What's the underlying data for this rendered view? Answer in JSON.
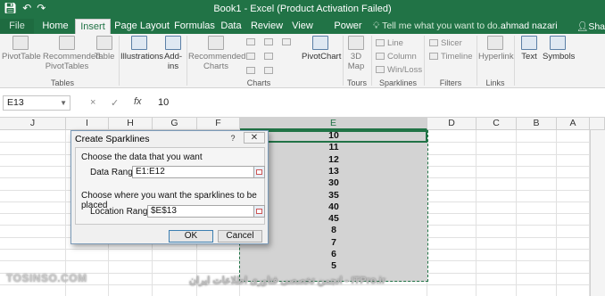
{
  "window": {
    "title": "Book1 - Excel (Product Activation Failed)",
    "save_icon": "save-icon",
    "undo_icon": "undo-icon",
    "redo_icon": "redo-icon"
  },
  "tabs": [
    "File",
    "Home",
    "Insert",
    "Page Layout",
    "Formulas",
    "Data",
    "Review",
    "View",
    "Power Pivot"
  ],
  "active_tab": "Insert",
  "tell_me": "Tell me what you want to do...",
  "user": "ahmad nazari",
  "share": "Shar",
  "ribbon": {
    "pivottable": "PivotTable",
    "recommended_pivottables": "Recommended PivotTables",
    "table": "Table",
    "tables_group": "Tables",
    "illustrations": "Illustrations",
    "addins": "Add-ins",
    "recommended_charts": "Recommended Charts",
    "pivotchart": "PivotChart",
    "charts_group": "Charts",
    "map3d": "3D Map",
    "tours_group": "Tours",
    "line": "Line",
    "column": "Column",
    "winloss": "Win/Loss",
    "sparklines_group": "Sparklines",
    "slicer": "Slicer",
    "timeline": "Timeline",
    "filters_group": "Filters",
    "hyperlink": "Hyperlink",
    "links_group": "Links",
    "text": "Text",
    "symbols": "Symbols"
  },
  "formula_bar": {
    "name_box": "E13",
    "cancel": "×",
    "enter": "✓",
    "fx": "fx",
    "value": "10"
  },
  "columns": [
    "J",
    "I",
    "H",
    "G",
    "F",
    "E",
    "D",
    "C",
    "B",
    "A"
  ],
  "selected_column": "E",
  "e_values": [
    "10",
    "11",
    "12",
    "13",
    "30",
    "35",
    "40",
    "45",
    "8",
    "7",
    "6",
    "5"
  ],
  "dialog": {
    "title": "Create Sparklines",
    "help": "?",
    "close": "✕",
    "section1": "Choose the data that you want",
    "data_range_label": "Data Range:",
    "data_range_value": "E1:E12",
    "section2": "Choose where you want the sparklines to be placed",
    "location_label": "Location Range:",
    "location_value": "$E$13",
    "ok": "OK",
    "cancel": "Cancel"
  },
  "watermark": {
    "left": "TOSINSO.COM",
    "right": "ITPro.ir - انجمن تخصصی فناوری اطلاعات ایران"
  }
}
